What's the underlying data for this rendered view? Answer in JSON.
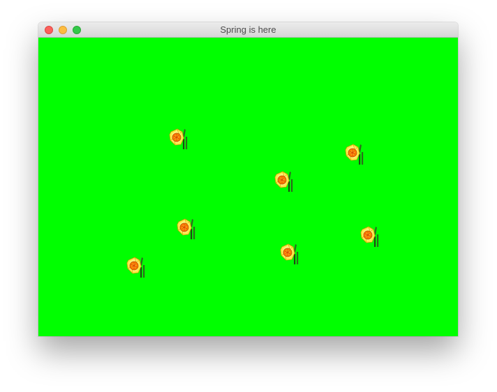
{
  "window": {
    "title": "Spring is here",
    "background_color": "#00ff00",
    "traffic_lights": [
      {
        "name": "close",
        "color": "#fc605c"
      },
      {
        "name": "minimize",
        "color": "#fdbc40"
      },
      {
        "name": "zoom",
        "color": "#34c84a"
      }
    ]
  },
  "flowers": [
    {
      "icon": "daffodil-icon"
    },
    {
      "icon": "daffodil-icon"
    },
    {
      "icon": "daffodil-icon"
    },
    {
      "icon": "daffodil-icon"
    },
    {
      "icon": "daffodil-icon"
    },
    {
      "icon": "daffodil-icon"
    },
    {
      "icon": "daffodil-icon"
    }
  ]
}
